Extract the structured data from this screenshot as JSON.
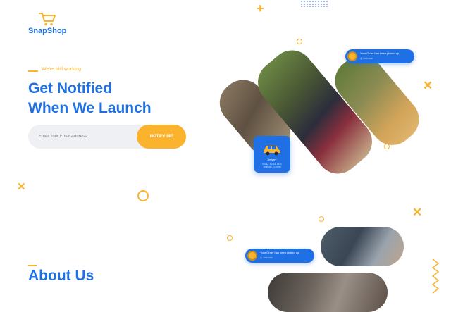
{
  "brand": {
    "name": "SnapShop",
    "icon": "shopping-cart-icon"
  },
  "hero": {
    "eyebrow": "We're still working",
    "headline_line1": "Get Notified",
    "headline_line2": "When We Launch"
  },
  "form": {
    "email_placeholder": "Enter Your Email Address",
    "email_value": "",
    "notify_label": "NOTIFY ME"
  },
  "notifications": [
    {
      "title": "Your Order has been picked up",
      "sub": "◎ Just now"
    },
    {
      "title": "Your Order has been picked up",
      "sub": "◎ Just now"
    }
  ],
  "delivery_card": {
    "title": "Delivery",
    "sub_line1": "Friday, Jan 12, 2024",
    "sub_line2": "10:30AM - 1:30PM",
    "icon": "car-icon"
  },
  "about": {
    "title": "About Us"
  },
  "colors": {
    "primary": "#1f6fe5",
    "accent": "#fbb32e",
    "field_bg": "#eef0f3"
  }
}
